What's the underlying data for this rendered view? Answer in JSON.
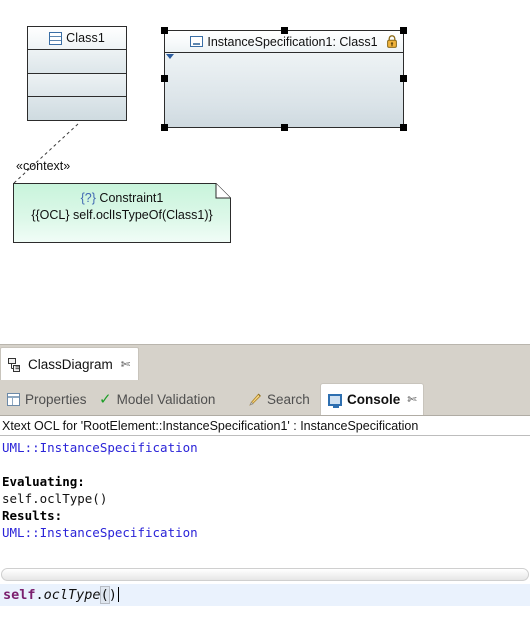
{
  "diagram": {
    "class_node": {
      "name": "Class1",
      "icon": "class-icon",
      "compartments": [
        "",
        "",
        ""
      ]
    },
    "instance_node": {
      "name": "InstanceSpecification1: Class1",
      "icon": "instance-specification-icon",
      "badge_icon": "lock-warning-icon",
      "selected": true,
      "marker_icon": "collapse-triangle-icon"
    },
    "link": {
      "label": "«context»",
      "style": "dashed"
    },
    "constraint_note": {
      "brace_open": "{?}",
      "title": "Constraint1",
      "body": "{{OCL} self.oclIsTypeOf(Class1)}",
      "fill_color": "#ccf5dd"
    }
  },
  "editor_tabs": [
    {
      "label": "ClassDiagram",
      "icon": "class-diagram-icon",
      "active": true,
      "closable": true,
      "close_glyph": "✄"
    }
  ],
  "view_tabs": [
    {
      "label": "Properties",
      "icon": "properties-icon",
      "active": false,
      "closable": false
    },
    {
      "label": "Model Validation",
      "icon": "green-check-icon",
      "active": false,
      "closable": false
    },
    {
      "label": "Search",
      "icon": "search-pencil-icon",
      "active": false,
      "closable": false
    },
    {
      "label": "Console",
      "icon": "console-monitor-icon",
      "active": true,
      "closable": true,
      "close_glyph": "✄"
    }
  ],
  "console": {
    "header": "Xtext OCL for 'RootElement::InstanceSpecification1' : InstanceSpecification",
    "lines": [
      {
        "text": "UML::InstanceSpecification",
        "style": "blue"
      },
      {
        "text": "",
        "style": "plain"
      },
      {
        "text": "Evaluating:",
        "style": "bold"
      },
      {
        "text": "self.oclType()",
        "style": "plain"
      },
      {
        "text": "Results:",
        "style": "bold"
      },
      {
        "text": "UML::InstanceSpecification",
        "style": "blue"
      }
    ],
    "input": {
      "self_token": "self",
      "dot_token": ".",
      "call_token": "oclType",
      "open_paren": "(",
      "close_paren": ")"
    }
  },
  "colors": {
    "accent_blue": "#2b24d8",
    "note_green": "#ccf5dd",
    "node_blue_grey": "#dfe7ea",
    "tab_bar": "#d6d2ca",
    "input_bg": "#eaf2fd",
    "keyword_purple": "#7b1f6e"
  }
}
